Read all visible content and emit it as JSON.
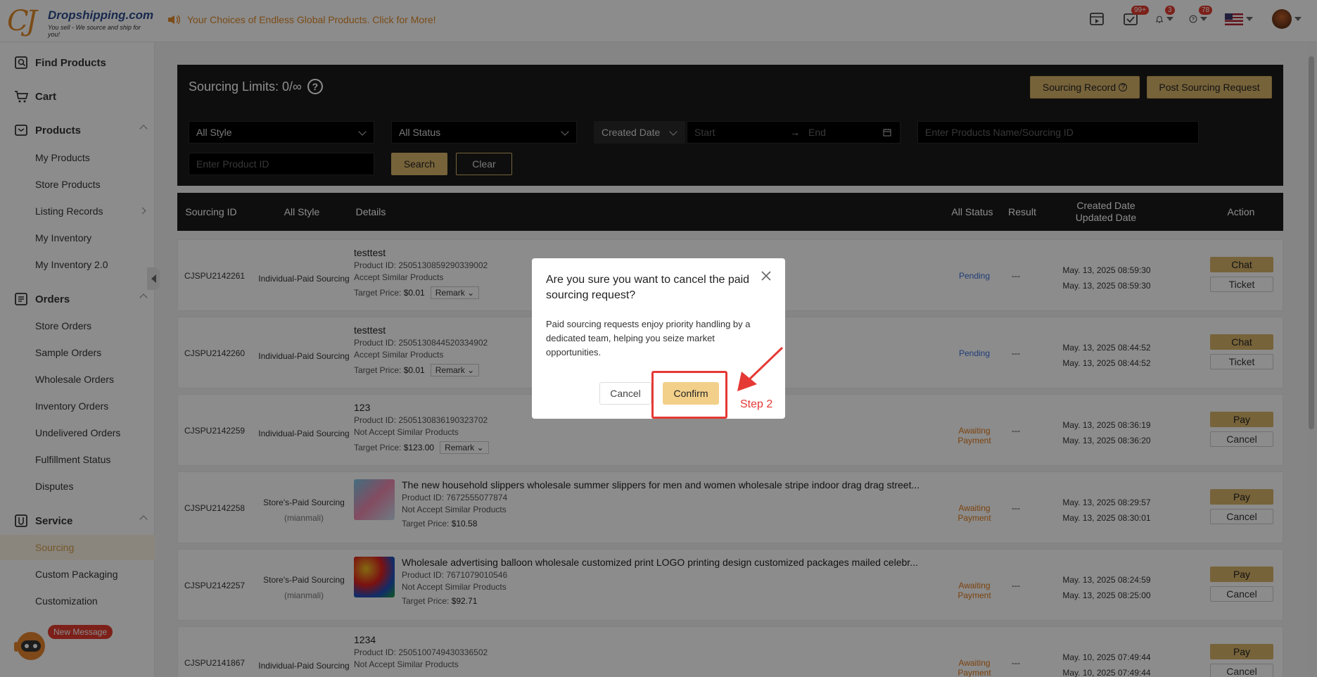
{
  "header": {
    "logo_brand": "Dropshipping.com",
    "logo_tagline": "You sell - We source and ship for you!",
    "announcement": "Your Choices of Endless Global Products. Click for More!",
    "badges": {
      "tasks": "99+",
      "notifications": "3",
      "help": "78"
    }
  },
  "sidebar": {
    "find_products": "Find Products",
    "cart": "Cart",
    "products": "Products",
    "products_items": [
      "My Products",
      "Store Products",
      "Listing Records",
      "My Inventory",
      "My Inventory 2.0"
    ],
    "orders": "Orders",
    "orders_items": [
      "Store Orders",
      "Sample Orders",
      "Wholesale Orders",
      "Inventory Orders",
      "Undelivered Orders",
      "Fulfillment Status",
      "Disputes"
    ],
    "service": "Service",
    "service_items": [
      "Sourcing",
      "Custom Packaging",
      "Customization"
    ],
    "new_message": "New Message"
  },
  "panel": {
    "title": "Sourcing Limits: 0/∞",
    "sourcing_record": "Sourcing Record",
    "post_request": "Post Sourcing Request",
    "style_select": "All Style",
    "status_select": "All Status",
    "date_select": "Created Date",
    "start_placeholder": "Start",
    "end_placeholder": "End",
    "name_placeholder": "Enter Products Name/Sourcing ID",
    "product_id_placeholder": "Enter Product ID",
    "search": "Search",
    "clear": "Clear"
  },
  "table": {
    "headers": {
      "id": "Sourcing ID",
      "style": "All Style",
      "details": "Details",
      "status": "All Status",
      "result": "Result",
      "created": "Created Date",
      "updated": "Updated Date",
      "action": "Action"
    },
    "rows": [
      {
        "id": "CJSPU2142261",
        "style": "Individual-Paid Sourcing",
        "style2": "",
        "title": "testtest",
        "pid": "Product ID: 2505130859290339002",
        "similar": "Accept Similar Products",
        "price_label": "Target Price:",
        "price": "$0.01",
        "remark": "Remark",
        "status": "Pending",
        "result": "---",
        "created": "May. 13, 2025 08:59:30",
        "updated": "May. 13, 2025 08:59:30",
        "act1": "Chat",
        "act2": "Ticket"
      },
      {
        "id": "CJSPU2142260",
        "style": "Individual-Paid Sourcing",
        "style2": "",
        "title": "testtest",
        "pid": "Product ID: 2505130844520334902",
        "similar": "Accept Similar Products",
        "price_label": "Target Price:",
        "price": "$0.01",
        "remark": "Remark",
        "status": "Pending",
        "result": "---",
        "created": "May. 13, 2025 08:44:52",
        "updated": "May. 13, 2025 08:44:52",
        "act1": "Chat",
        "act2": "Ticket"
      },
      {
        "id": "CJSPU2142259",
        "style": "Individual-Paid Sourcing",
        "style2": "",
        "title": "123",
        "pid": "Product ID: 2505130836190323702",
        "similar": "Not Accept Similar Products",
        "price_label": "Target Price:",
        "price": "$123.00",
        "remark": "Remark",
        "status": "Awaiting Payment",
        "result": "---",
        "created": "May. 13, 2025 08:36:19",
        "updated": "May. 13, 2025 08:36:20",
        "act1": "Pay",
        "act2": "Cancel"
      },
      {
        "id": "CJSPU2142258",
        "style": "Store's-Paid Sourcing",
        "style2": "(mianmali)",
        "title": "The new household slippers wholesale summer slippers for men and women wholesale stripe indoor drag drag street...",
        "pid": "Product ID: 7672555077874",
        "similar": "Not Accept Similar Products",
        "price_label": "Target Price:",
        "price": "$10.58",
        "remark": "",
        "status": "Awaiting Payment",
        "result": "---",
        "created": "May. 13, 2025 08:29:57",
        "updated": "May. 13, 2025 08:30:01",
        "act1": "Pay",
        "act2": "Cancel"
      },
      {
        "id": "CJSPU2142257",
        "style": "Store's-Paid Sourcing",
        "style2": "(mianmali)",
        "title": "Wholesale advertising balloon wholesale customized print LOGO printing design customized packages mailed celebr...",
        "pid": "Product ID: 7671079010546",
        "similar": "Not Accept Similar Products",
        "price_label": "Target Price:",
        "price": "$92.71",
        "remark": "",
        "status": "Awaiting Payment",
        "result": "---",
        "created": "May. 13, 2025 08:24:59",
        "updated": "May. 13, 2025 08:25:00",
        "act1": "Pay",
        "act2": "Cancel"
      },
      {
        "id": "CJSPU2141867",
        "style": "Individual-Paid Sourcing",
        "style2": "",
        "title": "1234",
        "pid": "Product ID: 2505100749430336502",
        "similar": "Not Accept Similar Products",
        "price_label": "",
        "price": "",
        "remark": "",
        "status": "Awaiting Payment",
        "result": "---",
        "created": "May. 10, 2025 07:49:44",
        "updated": "May. 10, 2025 07:49:44",
        "act1": "Pay",
        "act2": "Cancel"
      }
    ]
  },
  "modal": {
    "title": "Are you sure you want to cancel the paid sourcing request?",
    "body": "Paid sourcing requests enjoy priority handling by a dedicated team, helping you seize market opportunities.",
    "cancel": "Cancel",
    "confirm": "Confirm"
  },
  "annotation": {
    "step": "Step 2",
    "color": "#e53935"
  },
  "colors": {
    "accent": "#d9b46a",
    "dark_panel": "#1b1b1b",
    "pending": "#3a6fd8",
    "awaiting": "#e07a1a"
  }
}
